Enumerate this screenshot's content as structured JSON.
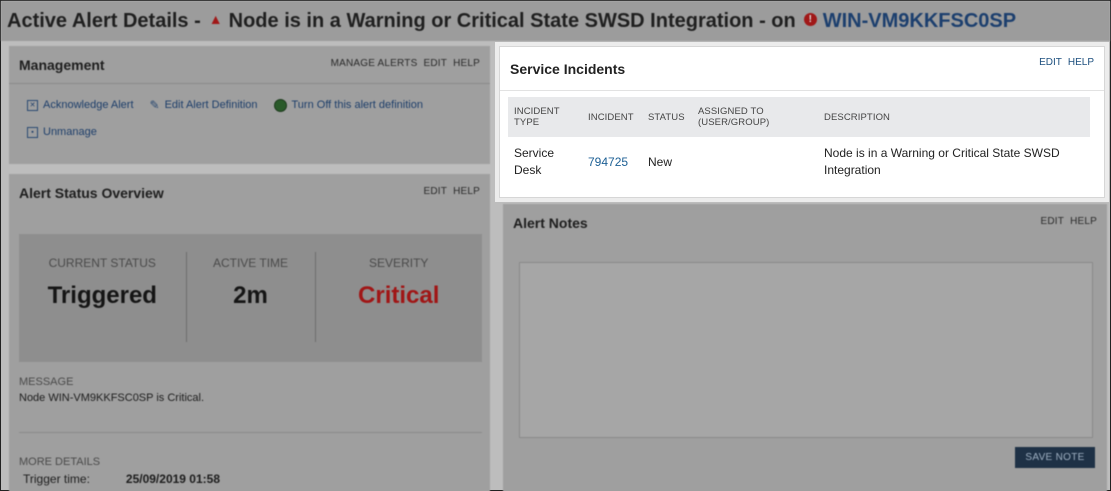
{
  "header": {
    "prefix": "Active Alert Details -",
    "alert_name": "Node is in a Warning or Critical State SWSD Integration - on",
    "node": "WIN-VM9KKFSC0SP"
  },
  "management": {
    "title": "Management",
    "links": [
      "MANAGE ALERTS",
      "EDIT",
      "HELP"
    ],
    "acknowledge": "Acknowledge Alert",
    "edit_definition": "Edit Alert Definition",
    "turn_off": "Turn Off this alert definition",
    "unmanage": "Unmanage"
  },
  "status_overview": {
    "title": "Alert Status Overview",
    "links": [
      "EDIT",
      "HELP"
    ],
    "current_status_label": "CURRENT STATUS",
    "current_status": "Triggered",
    "active_time_label": "ACTIVE TIME",
    "active_time": "2m",
    "severity_label": "SEVERITY",
    "severity": "Critical",
    "message_label": "MESSAGE",
    "message": "Node WIN-VM9KKFSC0SP is Critical.",
    "more_details_label": "MORE DETAILS",
    "trigger_time_label": "Trigger time:",
    "trigger_time": "25/09/2019 01:58"
  },
  "service_incidents": {
    "title": "Service Incidents",
    "links": [
      "EDIT",
      "HELP"
    ],
    "columns": [
      "INCIDENT TYPE",
      "INCIDENT",
      "STATUS",
      "ASSIGNED TO (USER/GROUP)",
      "DESCRIPTION"
    ],
    "rows": [
      {
        "type": "Service Desk",
        "incident": "794725",
        "status": "New",
        "assigned": "",
        "description": "Node is in a Warning or Critical State SWSD Integration"
      }
    ]
  },
  "alert_notes": {
    "title": "Alert Notes",
    "links": [
      "EDIT",
      "HELP"
    ],
    "note_value": "",
    "save_label": "SAVE NOTE"
  },
  "colors": {
    "critical": "#a01616",
    "link": "#1c5f94",
    "button": "#1e3146"
  },
  "icons": [
    "warning-triangle-icon",
    "error-circle-icon",
    "acknowledge-icon",
    "pencil-icon",
    "turn-off-icon",
    "unmanage-icon"
  ]
}
